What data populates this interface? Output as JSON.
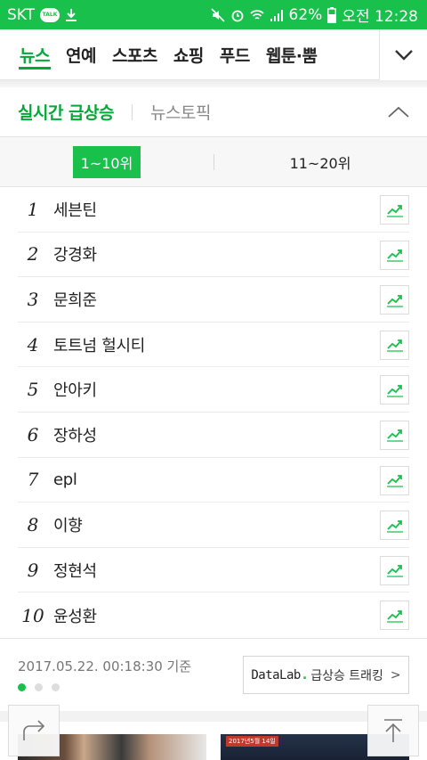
{
  "status_bar": {
    "carrier": "SKT",
    "talk_badge": "TALK",
    "battery": "62%",
    "time": "오전 12:28"
  },
  "nav": {
    "tabs": [
      {
        "label": "뉴스",
        "active": true
      },
      {
        "label": "연예",
        "active": false
      },
      {
        "label": "스포츠",
        "active": false
      },
      {
        "label": "쇼핑",
        "active": false
      },
      {
        "label": "푸드",
        "active": false
      },
      {
        "label": "웹툰·뿜",
        "active": false
      }
    ]
  },
  "section": {
    "title": "실시간 급상승",
    "title2": "뉴스토픽"
  },
  "range_tabs": {
    "first": "1~10위",
    "second": "11~20위"
  },
  "ranks": [
    {
      "rank": "1",
      "keyword": "세븐틴"
    },
    {
      "rank": "2",
      "keyword": "강경화"
    },
    {
      "rank": "3",
      "keyword": "문희준"
    },
    {
      "rank": "4",
      "keyword": "토트넘 헐시티"
    },
    {
      "rank": "5",
      "keyword": "안아키"
    },
    {
      "rank": "6",
      "keyword": "장하성"
    },
    {
      "rank": "7",
      "keyword": "epl"
    },
    {
      "rank": "8",
      "keyword": "이향"
    },
    {
      "rank": "9",
      "keyword": "정현석"
    },
    {
      "rank": "10",
      "keyword": "윤성환"
    }
  ],
  "footer": {
    "timestamp": "2017.05.22. 00:18:30 기준",
    "datalab_brand": "DataLab",
    "datalab_dot": ".",
    "datalab_label": "급상승 트래킹",
    "datalab_chevron": ">"
  },
  "pager": {
    "count": 3,
    "current": 1
  },
  "thumbs": {
    "t2_caption": "2017년5월 14일"
  },
  "colors": {
    "accent": "#19c04c",
    "accent_text": "#03a836"
  }
}
